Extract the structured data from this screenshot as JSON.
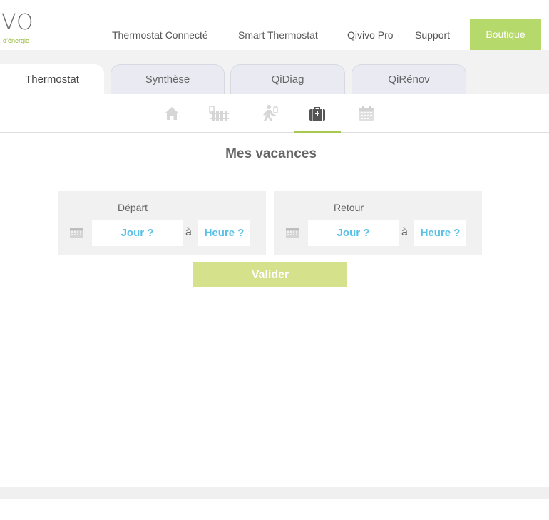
{
  "header": {
    "logo_text": "VO",
    "logo_tagline": "d’énergie",
    "nav": [
      {
        "label": "Thermostat Connecté"
      },
      {
        "label": "Smart Thermostat"
      },
      {
        "label": "Qivivo Pro"
      },
      {
        "label": "Support"
      }
    ],
    "cta_label": "Boutique"
  },
  "tabs": [
    {
      "label": "Thermostat",
      "active": true
    },
    {
      "label": "Synthèse",
      "active": false
    },
    {
      "label": "QiDiag",
      "active": false
    },
    {
      "label": "QiRénov",
      "active": false
    }
  ],
  "subnav": {
    "icons": [
      "home-icon",
      "radiator-icon",
      "walking-person-icon",
      "suitcase-icon",
      "calendar-icon"
    ],
    "active": "suitcase-icon"
  },
  "main": {
    "title": "Mes vacances",
    "departure": {
      "label": "Départ",
      "day_placeholder": "Jour ?",
      "separator": "à",
      "time_placeholder": "Heure ?"
    },
    "return": {
      "label": "Retour",
      "day_placeholder": "Jour ?",
      "separator": "à",
      "time_placeholder": "Heure ?"
    },
    "submit_label": "Valider"
  },
  "colors": {
    "accent_green": "#b6d96c",
    "link_blue": "#5bc0e6",
    "submit_green": "#d6e18c"
  }
}
